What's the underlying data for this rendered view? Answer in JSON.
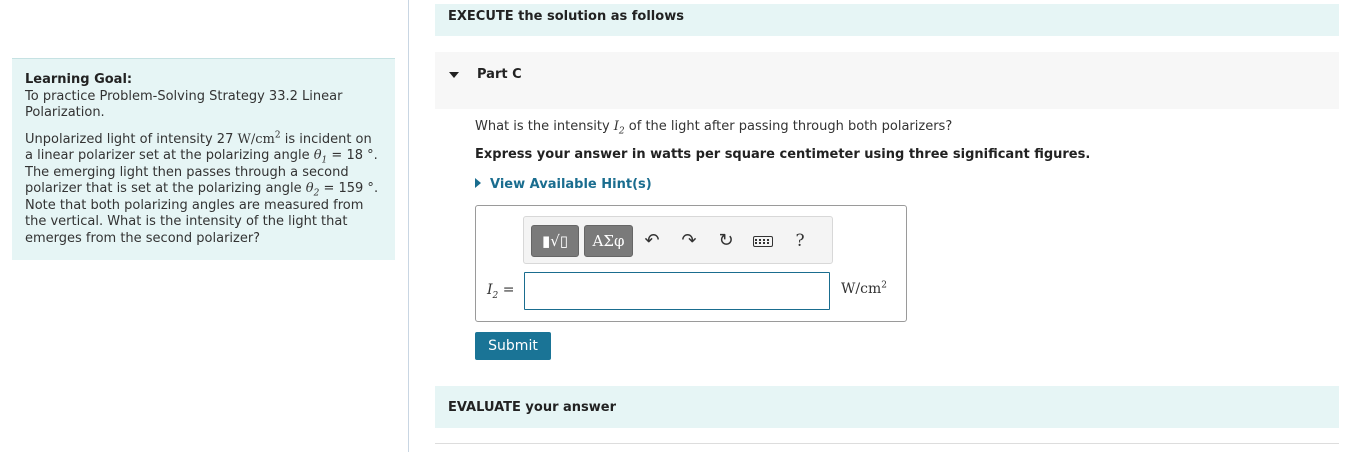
{
  "learning_goal": {
    "title": "Learning Goal:",
    "goal_text": "To practice Problem-Solving Strategy 33.2 Linear Polarization.",
    "problem": {
      "p1": "Unpolarized light of intensity 27 ",
      "unit": "W/cm",
      "unit_exp": "2",
      "p2": " is incident on a linear polarizer set at the polarizing angle ",
      "theta1_sym": "θ",
      "theta1_sub": "1",
      "theta1_val": " = 18 °",
      "p3": ". The emerging light then passes through a second polarizer that is set at the polarizing angle ",
      "theta2_sym": "θ",
      "theta2_sub": "2",
      "theta2_val": " = 159 °",
      "p4": ". Note that both polarizing angles are measured from the vertical. What is the intensity of the light that emerges from the second polarizer?"
    }
  },
  "sections": {
    "execute": "EXECUTE the solution as follows",
    "evaluate": "EVALUATE your answer"
  },
  "part": {
    "title": "Part C",
    "question_pre": "What is the intensity ",
    "question_sym": "I",
    "question_sub": "2",
    "question_post": " of the light after passing through both polarizers?",
    "instruction": "Express your answer in watts per square centimeter using three significant figures.",
    "hint_label": "View Available Hint(s)"
  },
  "answer": {
    "var_sym": "I",
    "var_sub": "2",
    "equals": " =",
    "input_value": "",
    "unit": "W/cm",
    "unit_exp": "2",
    "submit_label": "Submit"
  },
  "toolbar": {
    "templates_glyph": "▮√▯",
    "greek_label": "ΑΣφ",
    "undo_glyph": "↶",
    "redo_glyph": "↷",
    "reset_glyph": "↻",
    "help_label": "?"
  }
}
